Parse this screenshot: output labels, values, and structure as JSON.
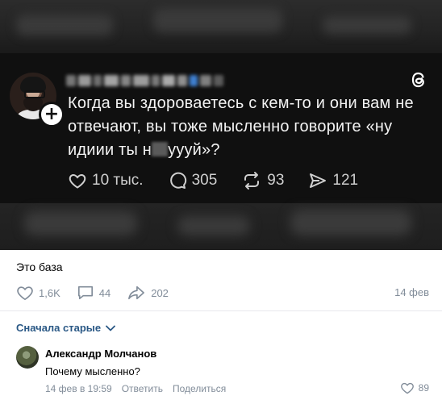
{
  "threads_post": {
    "text_part1": "Когда вы здороваетесь с кем-то и они вам не отвечают, вы тоже мысленно говорите «ну идиии ты н",
    "text_part2": "уууй»?",
    "likes": "10 тыс.",
    "comments": "305",
    "reposts": "93",
    "shares": "121",
    "follow_symbol": "+"
  },
  "vk_post": {
    "caption": "Это база",
    "likes": "1,6K",
    "comments": "44",
    "shares": "202",
    "date": "14 фев"
  },
  "sort": {
    "label": "Сначала старые"
  },
  "comment": {
    "author": "Александр Молчанов",
    "text": "Почему мысленно?",
    "time": "14 фев в 19:59",
    "reply_label": "Ответить",
    "share_label": "Поделиться",
    "likes": "89"
  },
  "colors": {
    "vk_link": "#2a5885",
    "vk_secondary": "#818c99",
    "threads_bg": "#101010"
  },
  "icons": [
    "heart-icon",
    "comment-icon",
    "repost-icon",
    "share-icon",
    "threads-logo-icon",
    "chevron-down-icon"
  ]
}
